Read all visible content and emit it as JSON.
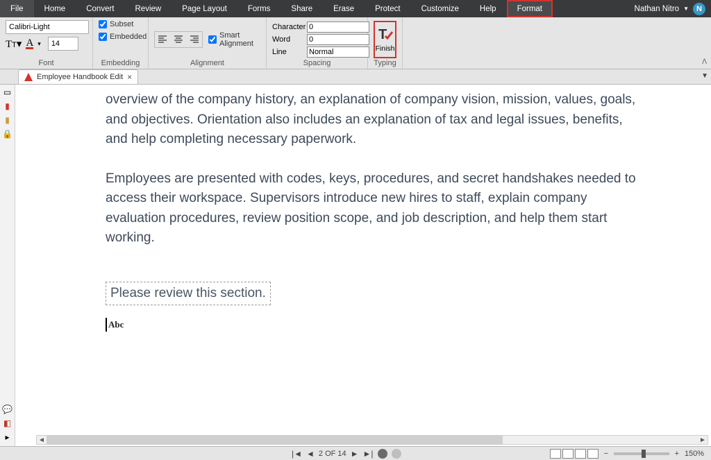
{
  "menubar": {
    "items": [
      "File",
      "Home",
      "Convert",
      "Review",
      "Page Layout",
      "Forms",
      "Share",
      "Erase",
      "Protect",
      "Customize",
      "Help",
      "Format"
    ],
    "highlighted": "Format"
  },
  "user": {
    "name": "Nathan Nitro",
    "initial": "N"
  },
  "ribbon": {
    "font": {
      "label": "Font",
      "name_value": "Calibri-Light",
      "size_value": "14"
    },
    "embedding": {
      "label": "Embedding",
      "subset": "Subset",
      "embedded": "Embedded"
    },
    "alignment": {
      "label": "Alignment",
      "smart": "Smart Alignment"
    },
    "spacing": {
      "label": "Spacing",
      "char_label": "Character",
      "char_value": "0",
      "word_label": "Word",
      "word_value": "0",
      "line_label": "Line",
      "line_value": "Normal"
    },
    "typing": {
      "label": "Typing",
      "finish": "Finish"
    }
  },
  "tab": {
    "title": "Employee Handbook Edit"
  },
  "document": {
    "para1": "overview of the company history, an explanation of company vision, mission, values, goals, and objectives. Orientation also includes an explanation of tax and legal issues, benefits, and help completing necessary paperwork.",
    "para2": "Employees are presented with codes, keys, procedures, and secret handshakes needed to access their workspace. Supervisors introduce new hires to staff, explain company evaluation procedures, review position scope, and job description, and help them start working.",
    "editbox": "Please review this section.",
    "abc": "Abc"
  },
  "status": {
    "page_of": "2 OF 14",
    "zoom": "150%"
  }
}
